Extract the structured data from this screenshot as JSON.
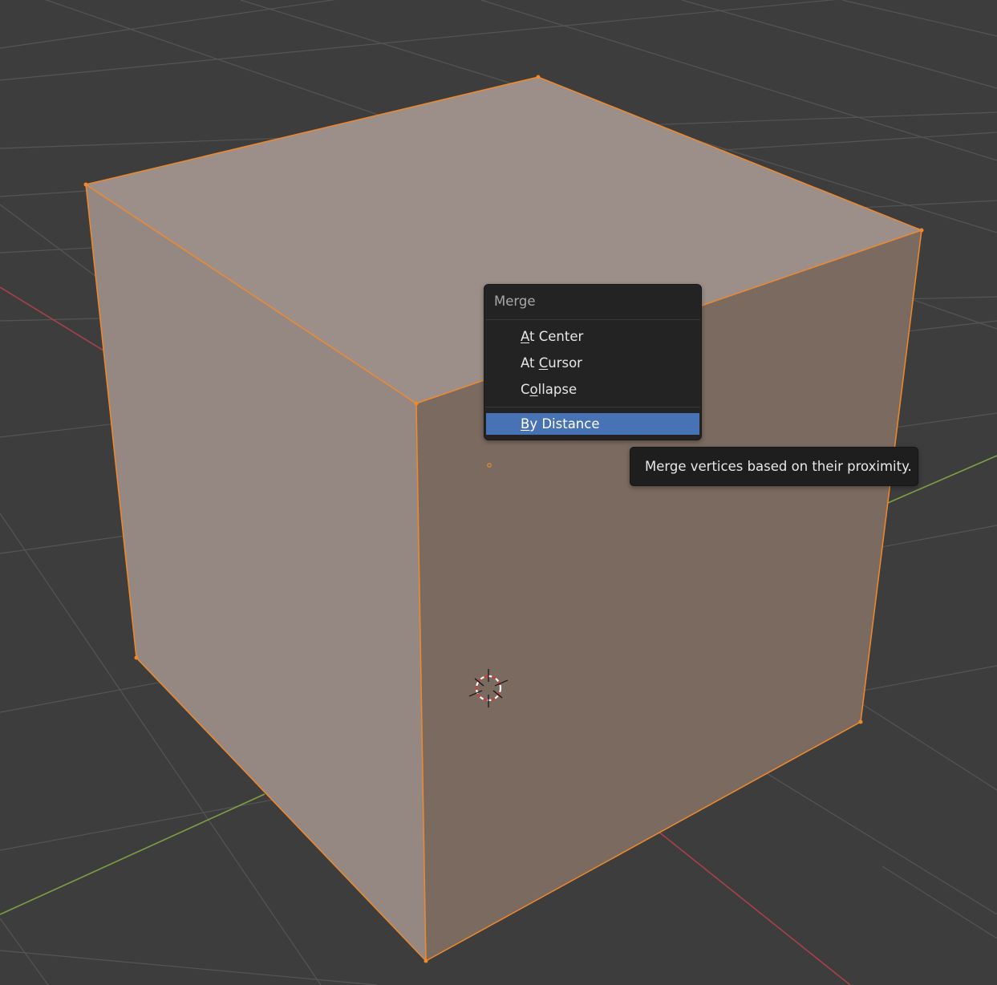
{
  "viewport": {
    "background_color": "#3d3d3d",
    "grid_color": "#555555",
    "x_axis_color": "#a8404a",
    "y_axis_color": "#7da043",
    "selection_color": "#f0892c",
    "face_top_color": "#9c8f8a",
    "face_left_color": "#958883",
    "face_right_color": "#7b6a60",
    "icons": {
      "cursor": "3d-cursor-icon",
      "vertex": "vertex-dot-icon"
    }
  },
  "menu": {
    "title": "Merge",
    "items": [
      {
        "ul": "A",
        "rest": "t Center",
        "pre": ""
      },
      {
        "pre": "At ",
        "ul": "C",
        "rest": "ursor"
      },
      {
        "pre": "C",
        "ul": "o",
        "rest": "llapse"
      },
      {
        "pre": "",
        "ul": "B",
        "rest": "y Distance"
      }
    ],
    "active_index": 3,
    "highlight_color": "#4772b3"
  },
  "tooltip": {
    "text": "Merge vertices based on their proximity."
  }
}
